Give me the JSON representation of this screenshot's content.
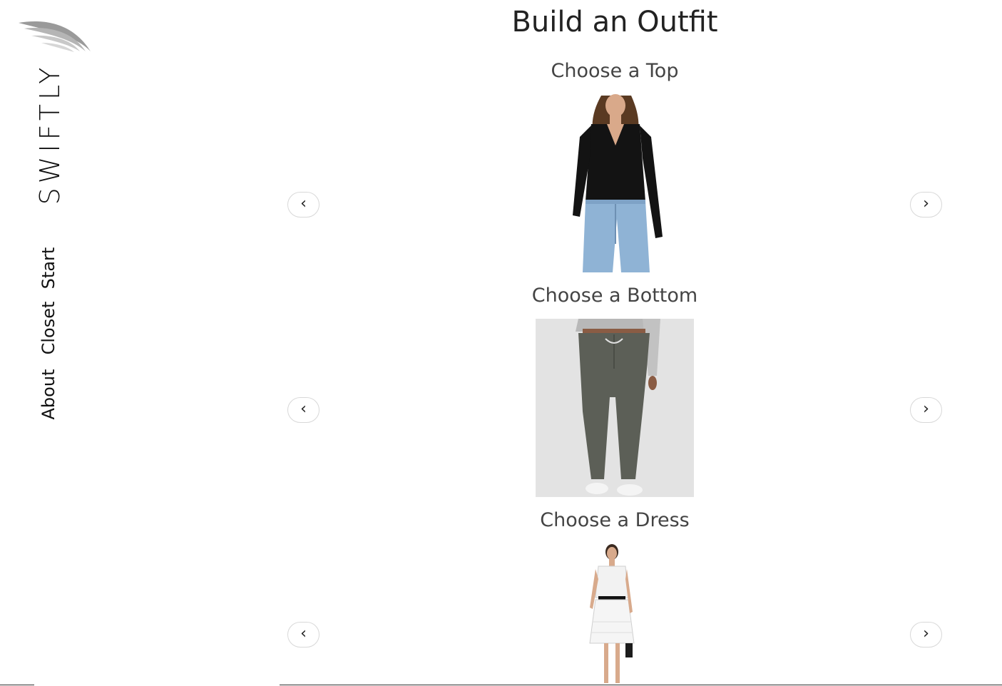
{
  "sidebar": {
    "brand": "SWIFTLY",
    "logo_icon": "wing-logo-icon",
    "nav": [
      {
        "label": "Start"
      },
      {
        "label": "Closet"
      },
      {
        "label": "About"
      }
    ]
  },
  "main": {
    "title": "Build an Outfit",
    "sections": [
      {
        "heading": "Choose a Top",
        "prev_label": "‹",
        "next_label": "›",
        "image": "black-v-neck-bodysuit"
      },
      {
        "heading": "Choose a Bottom",
        "prev_label": "‹",
        "next_label": "›",
        "image": "olive-jogger-pants"
      },
      {
        "heading": "Choose a Dress",
        "prev_label": "‹",
        "next_label": "›",
        "image": "white-lace-dress"
      }
    ]
  },
  "colors": {
    "background": "#ffffff",
    "text": "#222222",
    "button_border": "#d8d8d8"
  }
}
